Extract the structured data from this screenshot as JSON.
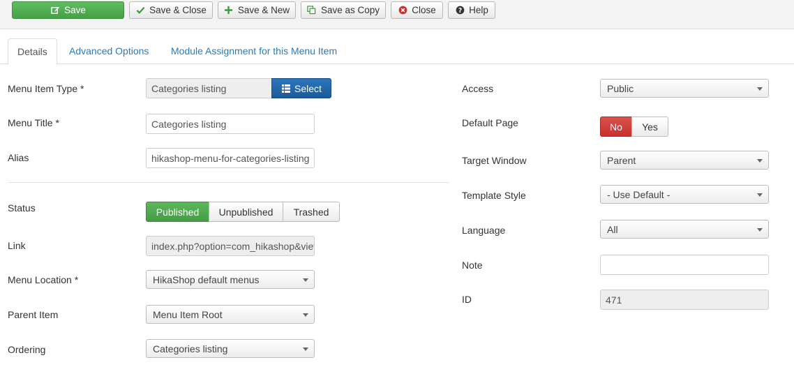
{
  "toolbar": {
    "save": "Save",
    "save_close": "Save & Close",
    "save_new": "Save & New",
    "save_copy": "Save as Copy",
    "close": "Close",
    "help": "Help"
  },
  "tabs": [
    {
      "label": "Details",
      "active": true
    },
    {
      "label": "Advanced Options",
      "active": false
    },
    {
      "label": "Module Assignment for this Menu Item",
      "active": false
    }
  ],
  "left": {
    "menu_item_type": {
      "label": "Menu Item Type *",
      "value": "Categories listing",
      "select_label": "Select"
    },
    "menu_title": {
      "label": "Menu Title *",
      "value": "Categories listing"
    },
    "alias": {
      "label": "Alias",
      "value": "hikashop-menu-for-categories-listing"
    },
    "status": {
      "label": "Status",
      "options": [
        "Published",
        "Unpublished",
        "Trashed"
      ],
      "selected": "Published"
    },
    "link": {
      "label": "Link",
      "value": "index.php?option=com_hikashop&view=category"
    },
    "menu_location": {
      "label": "Menu Location *",
      "value": "HikaShop default menus"
    },
    "parent_item": {
      "label": "Parent Item",
      "value": "Menu Item Root"
    },
    "ordering": {
      "label": "Ordering",
      "value": "Categories listing"
    }
  },
  "right": {
    "access": {
      "label": "Access",
      "value": "Public"
    },
    "default_page": {
      "label": "Default Page",
      "no": "No",
      "yes": "Yes",
      "selected": "No"
    },
    "target_window": {
      "label": "Target Window",
      "value": "Parent"
    },
    "template_style": {
      "label": "Template Style",
      "value": "- Use Default -"
    },
    "language": {
      "label": "Language",
      "value": "All"
    },
    "note": {
      "label": "Note",
      "value": ""
    },
    "id": {
      "label": "ID",
      "value": "471"
    }
  },
  "colors": {
    "success": "#5cb85c",
    "danger": "#d9534f",
    "primary": "#2b76bc",
    "link": "#2a7ab8"
  }
}
